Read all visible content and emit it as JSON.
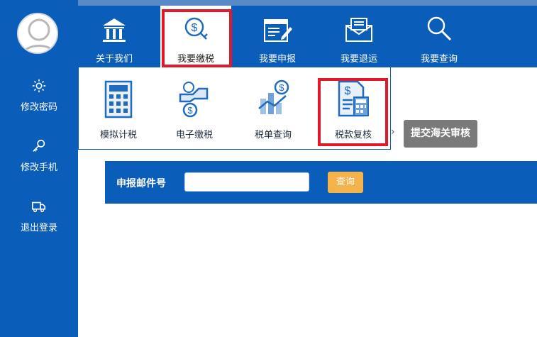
{
  "sidebar": {
    "items": [
      {
        "label": "修改密码",
        "icon": "gear-icon"
      },
      {
        "label": "修改手机",
        "icon": "key-icon"
      },
      {
        "label": "退出登录",
        "icon": "truck-icon"
      }
    ]
  },
  "topnav": {
    "items": [
      {
        "label": "关于我们",
        "icon": "bank-icon"
      },
      {
        "label": "我要缴税",
        "icon": "coin-tag-icon"
      },
      {
        "label": "我要申报",
        "icon": "form-edit-icon"
      },
      {
        "label": "我要退运",
        "icon": "envelope-icon"
      },
      {
        "label": "我要查询",
        "icon": "magnifier-icon"
      }
    ],
    "active_index": 1
  },
  "subnav": {
    "items": [
      {
        "label": "模拟计税",
        "icon": "calculator-icon"
      },
      {
        "label": "电子缴税",
        "icon": "hand-coin-icon"
      },
      {
        "label": "税单查询",
        "icon": "chart-coin-icon"
      },
      {
        "label": "税款复核",
        "icon": "document-calculator-icon"
      }
    ]
  },
  "submit_button": {
    "label": "提交海关审核"
  },
  "search": {
    "label": "申报邮件号",
    "placeholder": "",
    "button_label": "查询"
  },
  "colors": {
    "primary": "#0a5db8",
    "highlight": "#e11a2b",
    "button_orange": "#f4b24a",
    "button_gray": "#7a7a7a"
  }
}
